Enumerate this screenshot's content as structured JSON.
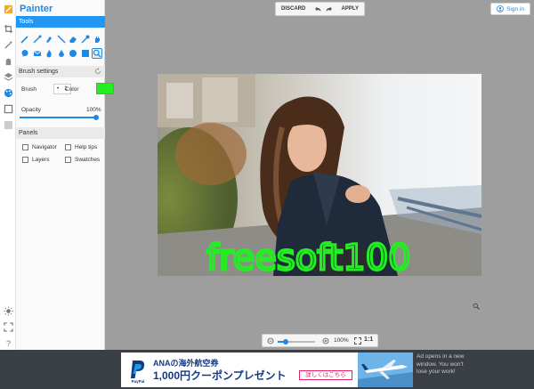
{
  "app": {
    "title": "Painter"
  },
  "toolbar": {
    "discard_label": "DISCARD",
    "apply_label": "APPLY"
  },
  "account": {
    "signin_label": "Sign in"
  },
  "sidebar": {
    "tools_header": "Tools",
    "brush_header": "Brush settings",
    "brush_label": "Brush",
    "brush_value": "1",
    "color_label": "Color",
    "color_value": "#22ee22",
    "opacity_label": "Opacity",
    "opacity_value": "100%",
    "panels_header": "Panels",
    "panels": {
      "navigator": "Navigator",
      "help_tips": "Help tips",
      "layers": "Layers",
      "swatches": "Swatches"
    }
  },
  "canvas": {
    "drawn_text": "freesoft100"
  },
  "zoom": {
    "percent": "100%",
    "ratio_label": "1:1"
  },
  "ad": {
    "headline": "ANAの海外航空券",
    "offer": "1,000円クーポンプレゼント",
    "cta": "詳しくはこちら",
    "brand": "PayPal"
  },
  "ad_note": "Ad opens in a new window. You won't lose your work!",
  "colors": {
    "accent": "#2196f3",
    "brush_color": "#22ee22",
    "ad_bar": "#3a3e45"
  }
}
